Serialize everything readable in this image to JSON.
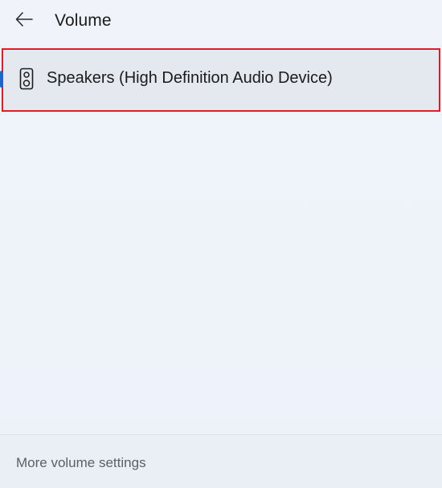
{
  "header": {
    "back_icon": "arrow-left-icon",
    "title": "Volume"
  },
  "devices": [
    {
      "icon": "speaker-icon",
      "label": "Speakers (High Definition Audio Device)",
      "selected": true
    }
  ],
  "footer": {
    "link_label": "More volume settings"
  },
  "colors": {
    "accent": "#1f64c8",
    "highlight_border": "#e21b24",
    "background": "#eef3fa",
    "selected_item_bg": "#e4e9ef"
  }
}
